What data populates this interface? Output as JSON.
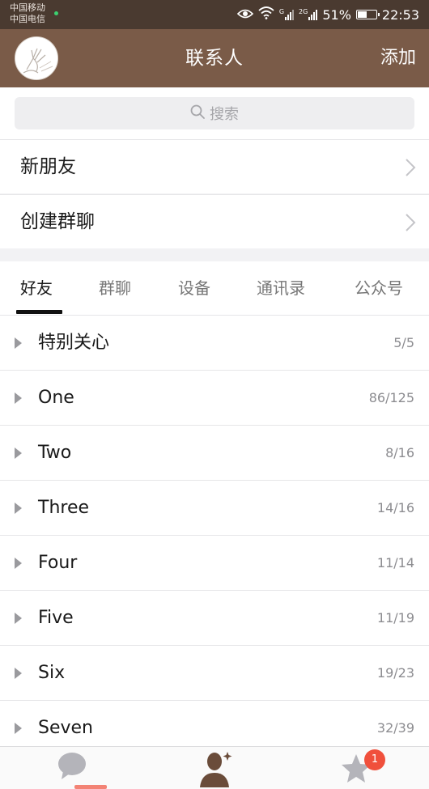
{
  "status_bar": {
    "carrier_1": "中国移动",
    "carrier_2": "中国电信",
    "sig1_tag": "G",
    "sig2_tag": "2G",
    "battery_percent": "51%",
    "battery_level": 0.51,
    "time": "22:53"
  },
  "header": {
    "title": "联系人",
    "add_label": "添加"
  },
  "search": {
    "placeholder": "搜索"
  },
  "menu": {
    "new_friends": "新朋友",
    "create_group": "创建群聊"
  },
  "tabs": [
    {
      "label": "好友",
      "active": true
    },
    {
      "label": "群聊",
      "active": false
    },
    {
      "label": "设备",
      "active": false
    },
    {
      "label": "通讯录",
      "active": false
    },
    {
      "label": "公众号",
      "active": false
    }
  ],
  "groups": [
    {
      "name": "特别关心",
      "count": "5/5"
    },
    {
      "name": "One",
      "count": "86/125"
    },
    {
      "name": "Two",
      "count": "8/16"
    },
    {
      "name": "Three",
      "count": "14/16"
    },
    {
      "name": "Four",
      "count": "11/14"
    },
    {
      "name": "Five",
      "count": "11/19"
    },
    {
      "name": "Six",
      "count": "19/23"
    },
    {
      "name": "Seven",
      "count": "32/39"
    }
  ],
  "bottom_nav": {
    "messages_icon": "chat-bubble-icon",
    "contacts_icon": "contacts-person-icon",
    "discover_icon": "star-icon",
    "badge_count": "1"
  },
  "colors": {
    "status_bar": "#4a3a30",
    "header": "#7a5b48",
    "badge": "#f0503c"
  }
}
